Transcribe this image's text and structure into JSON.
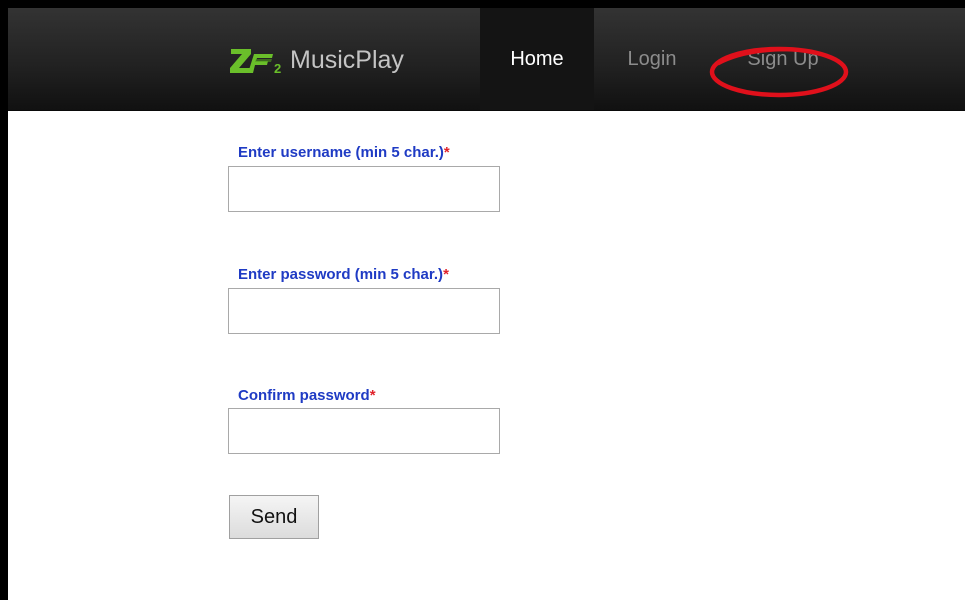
{
  "navbar": {
    "brand": {
      "logo_text": "ZF2",
      "name": "MusicPlay"
    },
    "items": [
      {
        "label": "Home",
        "active": true
      },
      {
        "label": "Login",
        "active": false
      },
      {
        "label": "Sign Up",
        "active": false,
        "annotated": true
      }
    ]
  },
  "form": {
    "fields": [
      {
        "label": "Enter username (min 5 char.)",
        "required_mark": "*",
        "value": "",
        "type": "text"
      },
      {
        "label": "Enter password (min 5 char.)",
        "required_mark": "*",
        "value": "",
        "type": "password"
      },
      {
        "label": "Confirm password",
        "required_mark": "*",
        "value": "",
        "type": "password"
      }
    ],
    "submit_label": "Send"
  },
  "colors": {
    "label": "#1f3bc4",
    "required": "#e0222a",
    "annotation": "#e0101b",
    "logo_green": "#6abf2a"
  }
}
